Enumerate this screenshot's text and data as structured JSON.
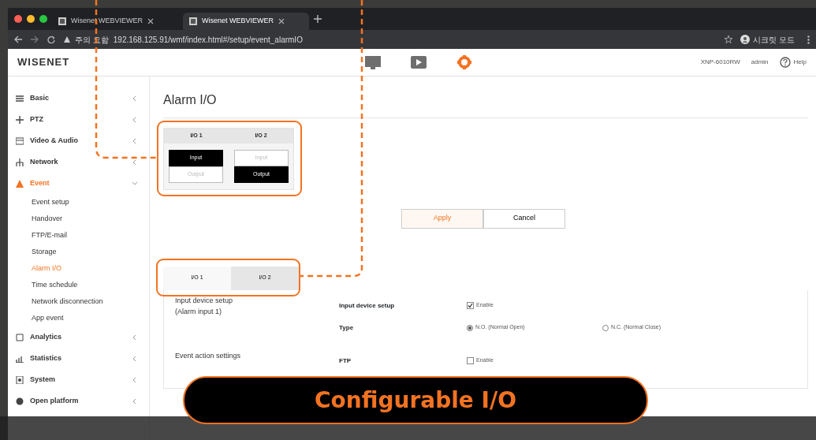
{
  "browser": {
    "tabs": [
      {
        "title": "Wisenet WEBVIEWER",
        "selected": false
      },
      {
        "title": "Wisenet WEBVIEWER",
        "selected": true
      }
    ],
    "security": "주의 요함",
    "address_host": "192.168.125.91",
    "address_path": "/wmf/index.html#/setup/event_alarmIO",
    "profile": "시크릿 모드"
  },
  "header": {
    "logo": "WISENET",
    "model": "XNP-6010RW",
    "user": "admin",
    "help": "Help",
    "modes": [
      {
        "kind": "monitor",
        "selected": false
      },
      {
        "kind": "playback",
        "selected": false
      },
      {
        "kind": "setup",
        "selected": true
      }
    ]
  },
  "sidebar": {
    "items": [
      {
        "label": "Basic",
        "expanded": false,
        "selected": false
      },
      {
        "label": "PTZ",
        "expanded": false,
        "selected": false
      },
      {
        "label": "Video & Audio",
        "expanded": false,
        "selected": false
      },
      {
        "label": "Network",
        "expanded": false,
        "selected": false
      },
      {
        "label": "Event",
        "expanded": true,
        "selected": true,
        "children": [
          {
            "label": "Event setup",
            "selected": false
          },
          {
            "label": "Handover",
            "selected": false
          },
          {
            "label": "FTP/E-mail",
            "selected": false
          },
          {
            "label": "Storage",
            "selected": false
          },
          {
            "label": "Alarm I/O",
            "selected": true
          },
          {
            "label": "Time schedule",
            "selected": false
          },
          {
            "label": "Network disconnection",
            "selected": false
          },
          {
            "label": "App event",
            "selected": false
          }
        ]
      },
      {
        "label": "Analytics",
        "expanded": false,
        "selected": false
      },
      {
        "label": "Statistics",
        "expanded": false,
        "selected": false
      },
      {
        "label": "System",
        "expanded": false,
        "selected": false
      },
      {
        "label": "Open platform",
        "expanded": false,
        "selected": false
      }
    ]
  },
  "page_title": "Alarm I/O",
  "io_ports": [
    {
      "label": "I/O 1",
      "options": [
        {
          "label": "Input",
          "selected": true
        },
        {
          "label": "Output",
          "selected": false
        }
      ]
    },
    {
      "label": "I/O 2",
      "options": [
        {
          "label": "Input",
          "selected": false
        },
        {
          "label": "Output",
          "selected": true
        }
      ]
    }
  ],
  "buttons": [
    {
      "label": "Apply",
      "kind": "primary"
    },
    {
      "label": "Cancel",
      "kind": "secondary"
    }
  ],
  "io_tabs": [
    {
      "label": "I/O 1",
      "selected": false
    },
    {
      "label": "I/O 2",
      "selected": true
    }
  ],
  "sections": [
    {
      "title": "Input device setup",
      "subtitle": "(Alarm input 1)",
      "rows": [
        {
          "label": "Input device setup",
          "kind": "checkbox",
          "options": [
            {
              "label": "Enable",
              "checked": true
            }
          ]
        },
        {
          "label": "Type",
          "kind": "radio",
          "options": [
            {
              "label": "N.O. (Normal Open)",
              "selected": true
            },
            {
              "label": "N.C. (Normal Close)",
              "selected": false
            }
          ]
        }
      ]
    },
    {
      "title": "Event action settings",
      "rows": [
        {
          "label": "FTP",
          "kind": "checkbox",
          "options": [
            {
              "label": "Enable",
              "checked": false
            }
          ]
        }
      ]
    }
  ],
  "caption": "Configurable I/O"
}
